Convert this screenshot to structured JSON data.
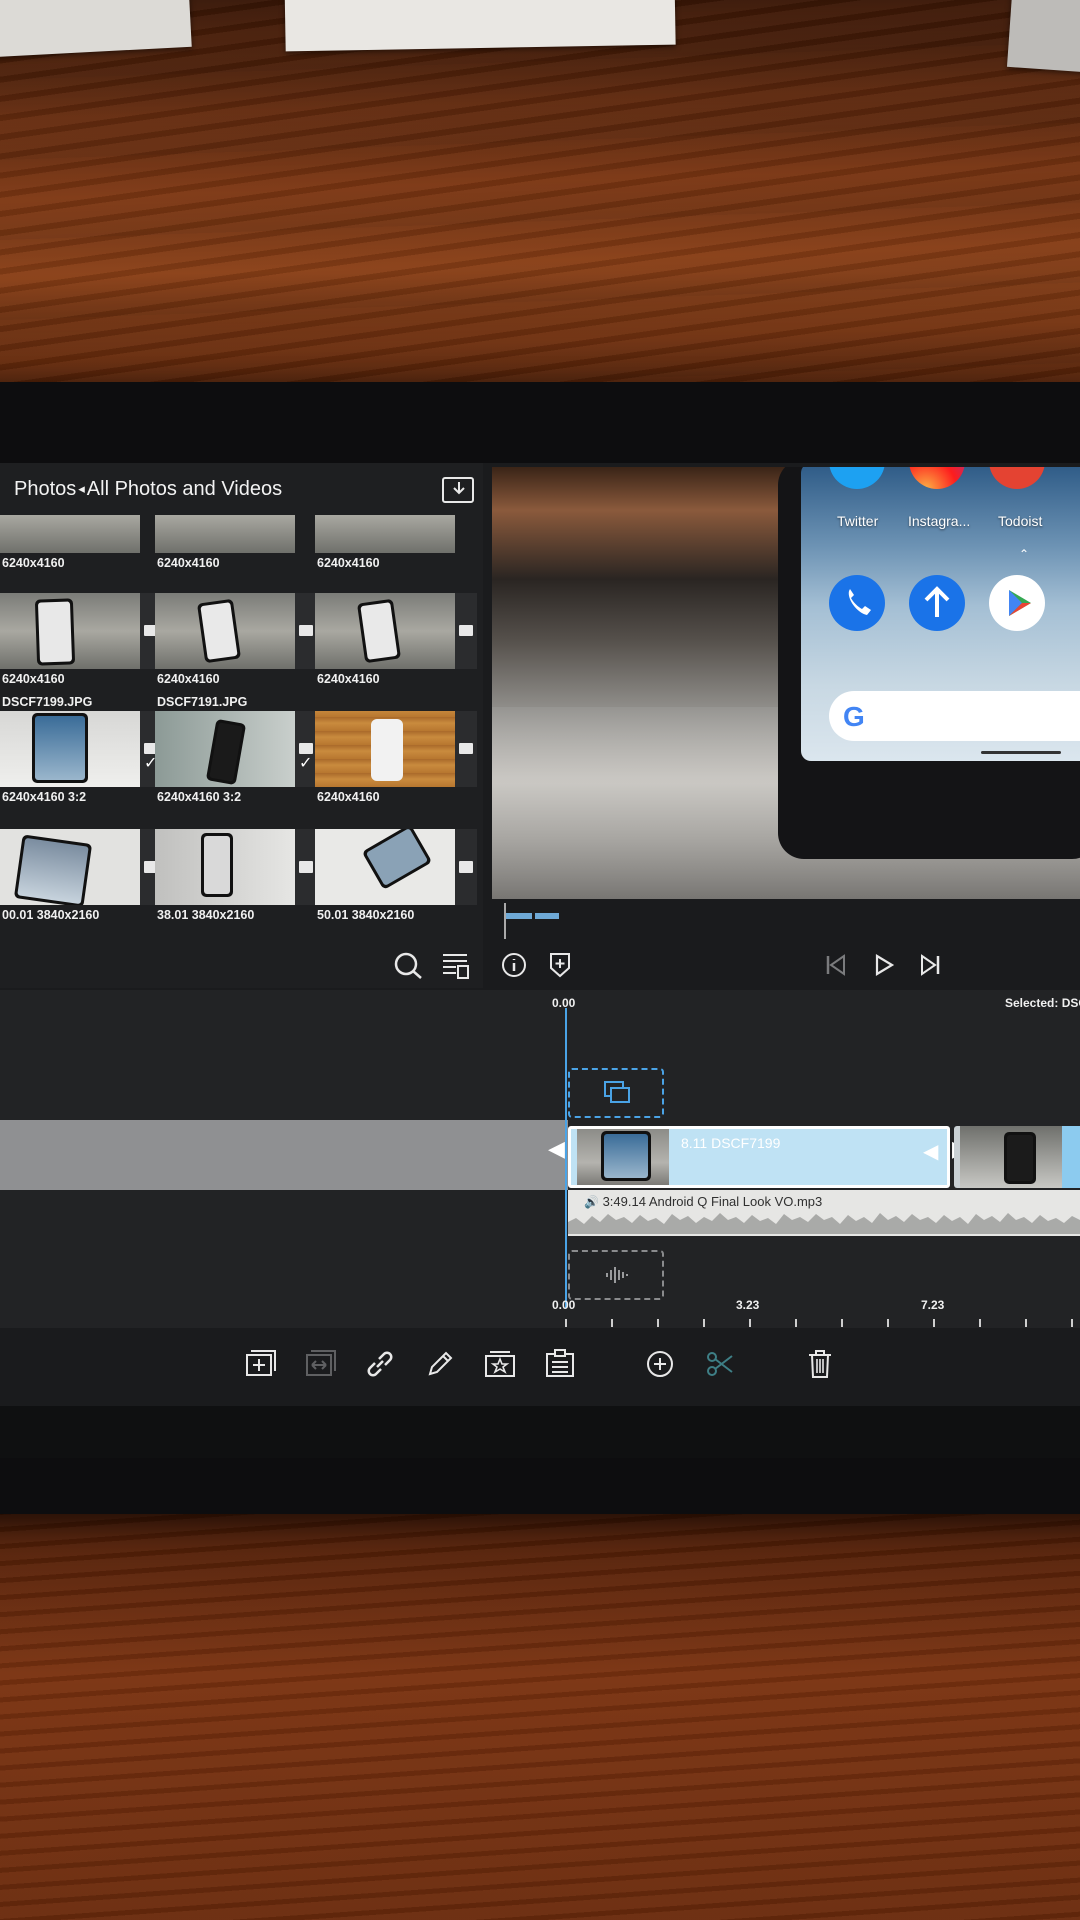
{
  "browser": {
    "breadcrumb_root": "Photos",
    "breadcrumb_separator": "◂",
    "breadcrumb_current": "All Photos and Videos",
    "items": [
      {
        "caption": "6240x4160",
        "name": ""
      },
      {
        "caption": "6240x4160",
        "name": ""
      },
      {
        "caption": "6240x4160",
        "name": ""
      },
      {
        "caption": "6240x4160",
        "name": ""
      },
      {
        "caption": "6240x4160",
        "name": ""
      },
      {
        "caption": "6240x4160",
        "name": ""
      },
      {
        "caption": "6240x4160  3:2",
        "name": "DSCF7199.JPG",
        "checked": true
      },
      {
        "caption": "6240x4160  3:2",
        "name": "DSCF7191.JPG",
        "checked": true
      },
      {
        "caption": "6240x4160",
        "name": ""
      },
      {
        "caption": "00.01  3840x2160",
        "name": ""
      },
      {
        "caption": "38.01  3840x2160",
        "name": ""
      },
      {
        "caption": "50.01  3840x2160",
        "name": ""
      }
    ]
  },
  "preview": {
    "apps_row1": [
      "Twitter",
      "Instagra...",
      "Todoist"
    ]
  },
  "timeline": {
    "top_time": "0.00",
    "selected_label": "Selected: DSC",
    "clip_label": "8.11   DSCF7199",
    "audio_label": "3:49.14   Android Q Final Look VO.mp3",
    "ruler": [
      "0.00",
      "3.23",
      "7.23"
    ]
  },
  "toolbar": {
    "buttons": [
      "add-clip-icon",
      "replace-clip-icon",
      "link-icon",
      "edit-pencil-icon",
      "favorite-icon",
      "clipboard-icon",
      "add-circle-icon",
      "scissors-icon",
      "trash-icon"
    ]
  }
}
